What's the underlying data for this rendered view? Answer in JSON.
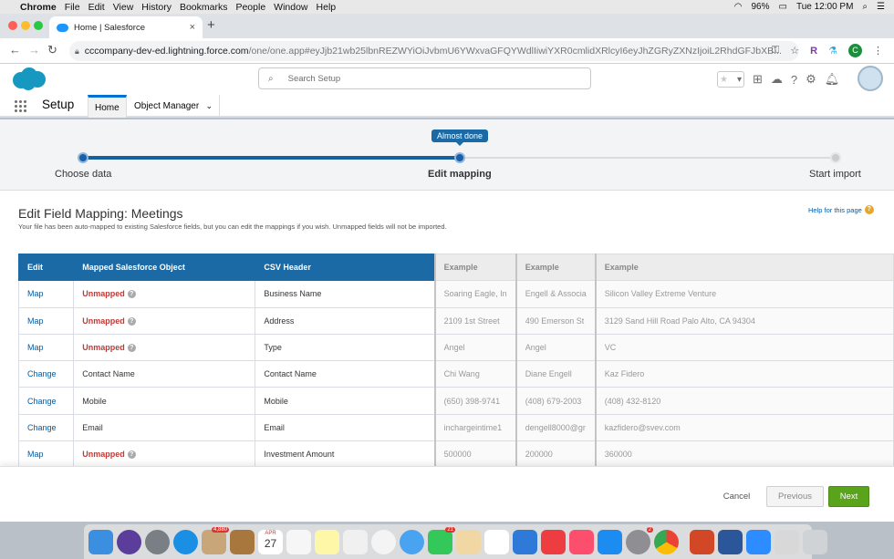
{
  "macos_menubar": {
    "app": "Chrome",
    "items": [
      "File",
      "Edit",
      "View",
      "History",
      "Bookmarks",
      "People",
      "Window",
      "Help"
    ],
    "battery": "96%",
    "clock": "Tue 12:00 PM"
  },
  "browser": {
    "tab_title": "Home | Salesforce",
    "url_host": "cccompany-dev-ed.lightning.force.com",
    "url_path": "/one/one.app#eyJjb21wb25lbnREZWYiOiJvbmU6YWxvaGFQYWdlIiwiYXR0cmlidXRlcyI6eyJhZGRyZXNzIjoiL2RhdGFJbXB...",
    "profile_initial": "C"
  },
  "salesforce_header": {
    "search_placeholder": "Search Setup"
  },
  "nav": {
    "app_name": "Setup",
    "tabs": [
      "Home",
      "Object Manager"
    ]
  },
  "wizard": {
    "tooltip": "Almost done",
    "steps": [
      "Choose data",
      "Edit mapping",
      "Start import"
    ],
    "current_step": 2
  },
  "page": {
    "title": "Edit Field Mapping: Meetings",
    "subtitle": "Your file has been auto-mapped to existing Salesforce fields, but you can edit the mappings if you wish. Unmapped fields will not be imported.",
    "help_link": "Help for this page"
  },
  "mapping_table": {
    "headers": [
      "Edit",
      "Mapped Salesforce Object",
      "CSV Header",
      "Example",
      "Example",
      "Example"
    ],
    "rows": [
      {
        "edit": "Map",
        "mapped": "Unmapped",
        "csv": "Business Name",
        "ex1": "Soaring Eagle, In",
        "ex2": "Engell & Associa",
        "ex3": "Silicon Valley Extreme Venture"
      },
      {
        "edit": "Map",
        "mapped": "Unmapped",
        "csv": "Address",
        "ex1": "2109 1st Street",
        "ex2": "490 Emerson St",
        "ex3": "3129 Sand Hill Road Palo Alto, CA 94304"
      },
      {
        "edit": "Map",
        "mapped": "Unmapped",
        "csv": "Type",
        "ex1": "Angel",
        "ex2": "Angel",
        "ex3": "VC"
      },
      {
        "edit": "Change",
        "mapped": "Contact Name",
        "csv": "Contact Name",
        "ex1": "Chi Wang",
        "ex2": "Diane Engell",
        "ex3": "Kaz Fidero"
      },
      {
        "edit": "Change",
        "mapped": "Mobile",
        "csv": "Mobile",
        "ex1": "(650) 398-9741",
        "ex2": "(408) 679-2003",
        "ex3": "(408) 432-8120"
      },
      {
        "edit": "Change",
        "mapped": "Email",
        "csv": "Email",
        "ex1": "inchargeintime1",
        "ex2": "dengell8000@gr",
        "ex3": "kazfidero@svev.com"
      },
      {
        "edit": "Map",
        "mapped": "Unmapped",
        "csv": "Investment Amount",
        "ex1": "500000",
        "ex2": "200000",
        "ex3": "360000"
      }
    ]
  },
  "footer": {
    "cancel": "Cancel",
    "previous": "Previous",
    "next": "Next"
  },
  "dock": {
    "badges": [
      "4,880",
      "21",
      "2"
    ],
    "calendar_month": "APR",
    "calendar_day": "27"
  },
  "colors": {
    "brand_blue": "#1b6aa5",
    "unmapped_red": "#c23934",
    "next_green": "#5aa41b",
    "link_blue": "#015ba7"
  }
}
